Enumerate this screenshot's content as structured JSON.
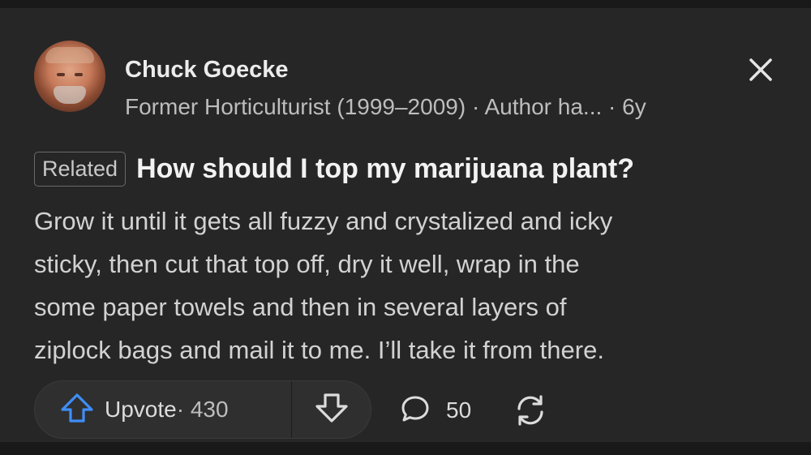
{
  "author": {
    "name": "Chuck Goecke",
    "credential": "Former Horticulturist (1999–2009) · Author ha... · 6y"
  },
  "related": {
    "badge": "Related",
    "question": "How should I top my marijuana plant?"
  },
  "answer": {
    "lines": [
      "Grow it until it gets all fuzzy and crystalized and icky",
      "sticky, then cut that top off, dry it well, wrap in the",
      "some paper towels and then in several layers of",
      "ziplock bags and mail it to me. I’ll take it from there."
    ]
  },
  "actions": {
    "upvote_label": "Upvote",
    "upvote_count": " · 430",
    "comments_count": "50"
  },
  "icons": {
    "close": "close-icon",
    "upvote": "arrow-up-icon",
    "downvote": "arrow-down-icon",
    "comment": "comment-bubble-icon",
    "share": "share-icon"
  },
  "colors": {
    "background": "#262626",
    "accent_upvote": "#3e8ef7",
    "text_primary": "#ececec",
    "text_secondary": "#bdbdbd"
  }
}
